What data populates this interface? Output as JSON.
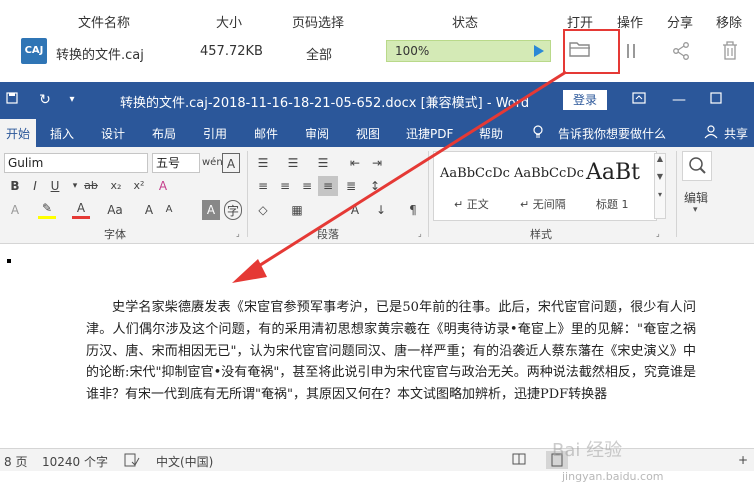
{
  "converter": {
    "headers": [
      "文件名称",
      "大小",
      "页码选择",
      "状态",
      "打开",
      "操作",
      "分享",
      "移除"
    ],
    "file_icon": "CAJ",
    "file_name": "转换的文件.caj",
    "file_size": "457.72KB",
    "page_selection": "全部",
    "status_text": "100%",
    "progress": 1.0,
    "icons": {
      "open": "folder-icon",
      "pause": "pause-icon",
      "share": "share-icon",
      "remove": "trash-icon"
    },
    "highlight_color": "#e53935"
  },
  "word": {
    "title": "转换的文件.caj-2018-11-16-18-21-05-652.docx [兼容模式]  -  Word",
    "login": "登录",
    "tabs": [
      "开始",
      "插入",
      "设计",
      "布局",
      "引用",
      "邮件",
      "审阅",
      "视图",
      "迅捷PDF",
      "帮助"
    ],
    "tell_me": "告诉我你想要做什么",
    "share": "共享",
    "font_name": "Gulim",
    "font_size": "五号",
    "group_font": "字体",
    "group_paragraph": "段落",
    "group_styles": "样式",
    "edit_label": "编辑",
    "styles": [
      {
        "sample": "AaBbCcDc",
        "name": "↵ 正文"
      },
      {
        "sample": "AaBbCcDc",
        "name": "↵ 无间隔"
      },
      {
        "sample": "AaBt",
        "name": "标题 1"
      }
    ],
    "document_text": "史学名家柴德赓发表《宋宦官参预军事考沪，已是50年前的往事。此后，宋代宦官问题，很少有人问津。人们偶尔涉及这个问题，有的采用清初思想家黄宗羲在《明夷待访录•奄宦上》里的见解：\"奄宦之祸历汉、唐、宋而相因无已\"，认为宋代宦官问题同汉、唐一样严重；有的沿袭近人蔡东藩在《宋史演义》中的论断:宋代\"抑制宦官•没有奄祸\"，甚至将此说引申为宋代宦官与政治无关。两种说法截然相反，究竟谁是谁非？有宋一代到底有无所谓\"奄祸\"，其原因又何在？本文试图略加辨析，迅捷PDF转换器",
    "status_page": "8 页",
    "status_words": "10240 个字",
    "status_lang": "中文(中国)",
    "accent_color": "#2b579a"
  },
  "watermark": {
    "text": "Bai 经验",
    "url": "jingyan.baidu.com"
  }
}
